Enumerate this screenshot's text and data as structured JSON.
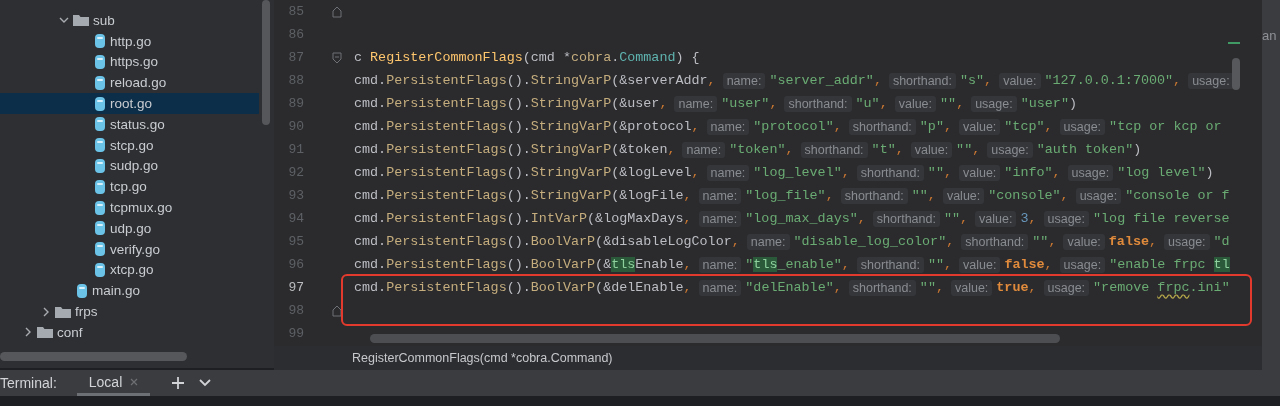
{
  "project_tree": [
    {
      "children": [
        {
          "children": [
            {
              "name": "sub",
              "kind": "folder",
              "expanded": true,
              "children": [
                {
                  "name": "http.go",
                  "kind": "file",
                  "selected": false
                },
                {
                  "name": "https.go",
                  "kind": "file",
                  "selected": false
                },
                {
                  "name": "reload.go",
                  "kind": "file",
                  "selected": false
                },
                {
                  "name": "root.go",
                  "kind": "file",
                  "selected": true
                },
                {
                  "name": "status.go",
                  "kind": "file",
                  "selected": false
                },
                {
                  "name": "stcp.go",
                  "kind": "file",
                  "selected": false
                },
                {
                  "name": "sudp.go",
                  "kind": "file",
                  "selected": false
                },
                {
                  "name": "tcp.go",
                  "kind": "file",
                  "selected": false
                },
                {
                  "name": "tcpmux.go",
                  "kind": "file",
                  "selected": false
                },
                {
                  "name": "udp.go",
                  "kind": "file",
                  "selected": false
                },
                {
                  "name": "verify.go",
                  "kind": "file",
                  "selected": false
                },
                {
                  "name": "xtcp.go",
                  "kind": "file",
                  "selected": false
                }
              ]
            },
            {
              "name": "main.go",
              "kind": "file",
              "selected": false
            }
          ]
        },
        {
          "name": "frps",
          "kind": "folder",
          "expanded": false
        }
      ]
    },
    {
      "name": "conf",
      "kind": "folder",
      "expanded": false
    }
  ],
  "editor": {
    "lines": [
      {
        "number": "85",
        "kind": "closer",
        "current": false,
        "boxed": false
      },
      {
        "number": "86",
        "kind": "plain",
        "current": false,
        "boxed": false
      },
      {
        "number": "87",
        "kind": "opener",
        "current": false,
        "boxed": false,
        "tokens": [
          {
            "kind": "plain",
            "text": "c "
          },
          {
            "kind": "func",
            "text": "RegisterCommonFlags"
          },
          {
            "kind": "plain",
            "text": "(cmd *"
          },
          {
            "kind": "method",
            "text": "cobra"
          },
          {
            "kind": "plain",
            "text": "."
          },
          {
            "kind": "type",
            "text": "Command"
          },
          {
            "kind": "plain",
            "text": ") {"
          }
        ]
      },
      {
        "number": "88",
        "kind": "plain",
        "current": false,
        "boxed": false,
        "tokens": [
          {
            "kind": "plain",
            "text": "cmd."
          },
          {
            "kind": "method",
            "text": "PersistentFlags"
          },
          {
            "kind": "plain",
            "text": "()."
          },
          {
            "kind": "method",
            "text": "StringVarP"
          },
          {
            "kind": "plain",
            "text": "(&serverAddr"
          },
          {
            "kind": "comma",
            "text": ","
          },
          {
            "kind": "hint",
            "text": "name:"
          },
          {
            "kind": "string",
            "text": "\"server_addr\""
          },
          {
            "kind": "comma",
            "text": ","
          },
          {
            "kind": "hint",
            "text": "shorthand:"
          },
          {
            "kind": "string",
            "text": "\"s\""
          },
          {
            "kind": "comma",
            "text": ","
          },
          {
            "kind": "hint",
            "text": "value:"
          },
          {
            "kind": "string",
            "text": "\"127.0.0.1:7000\""
          },
          {
            "kind": "comma",
            "text": ","
          },
          {
            "kind": "hint",
            "text": "usage:"
          }
        ]
      },
      {
        "number": "89",
        "kind": "plain",
        "current": false,
        "boxed": false,
        "tokens": [
          {
            "kind": "plain",
            "text": "cmd."
          },
          {
            "kind": "method",
            "text": "PersistentFlags"
          },
          {
            "kind": "plain",
            "text": "()."
          },
          {
            "kind": "method",
            "text": "StringVarP"
          },
          {
            "kind": "plain",
            "text": "(&user"
          },
          {
            "kind": "comma",
            "text": ","
          },
          {
            "kind": "hint",
            "text": "name:"
          },
          {
            "kind": "string",
            "text": "\"user\""
          },
          {
            "kind": "comma",
            "text": ","
          },
          {
            "kind": "hint",
            "text": "shorthand:"
          },
          {
            "kind": "string",
            "text": "\"u\""
          },
          {
            "kind": "comma",
            "text": ","
          },
          {
            "kind": "hint",
            "text": "value:"
          },
          {
            "kind": "string",
            "text": "\"\""
          },
          {
            "kind": "comma",
            "text": ","
          },
          {
            "kind": "hint",
            "text": "usage:"
          },
          {
            "kind": "string",
            "text": "\"user\""
          },
          {
            "kind": "plain",
            "text": ")"
          }
        ]
      },
      {
        "number": "90",
        "kind": "plain",
        "current": false,
        "boxed": false,
        "tokens": [
          {
            "kind": "plain",
            "text": "cmd."
          },
          {
            "kind": "method",
            "text": "PersistentFlags"
          },
          {
            "kind": "plain",
            "text": "()."
          },
          {
            "kind": "method",
            "text": "StringVarP"
          },
          {
            "kind": "plain",
            "text": "(&protocol"
          },
          {
            "kind": "comma",
            "text": ","
          },
          {
            "kind": "hint",
            "text": "name:"
          },
          {
            "kind": "string",
            "text": "\"protocol\""
          },
          {
            "kind": "comma",
            "text": ","
          },
          {
            "kind": "hint",
            "text": "shorthand:"
          },
          {
            "kind": "string",
            "text": "\"p\""
          },
          {
            "kind": "comma",
            "text": ","
          },
          {
            "kind": "hint",
            "text": "value:"
          },
          {
            "kind": "string",
            "text": "\"tcp\""
          },
          {
            "kind": "comma",
            "text": ","
          },
          {
            "kind": "hint",
            "text": "usage:"
          },
          {
            "kind": "string",
            "text": "\"tcp or kcp or"
          }
        ]
      },
      {
        "number": "91",
        "kind": "plain",
        "current": false,
        "boxed": false,
        "tokens": [
          {
            "kind": "plain",
            "text": "cmd."
          },
          {
            "kind": "method",
            "text": "PersistentFlags"
          },
          {
            "kind": "plain",
            "text": "()."
          },
          {
            "kind": "method",
            "text": "StringVarP"
          },
          {
            "kind": "plain",
            "text": "(&token"
          },
          {
            "kind": "comma",
            "text": ","
          },
          {
            "kind": "hint",
            "text": "name:"
          },
          {
            "kind": "string",
            "text": "\"token\""
          },
          {
            "kind": "comma",
            "text": ","
          },
          {
            "kind": "hint",
            "text": "shorthand:"
          },
          {
            "kind": "string",
            "text": "\"t\""
          },
          {
            "kind": "comma",
            "text": ","
          },
          {
            "kind": "hint",
            "text": "value:"
          },
          {
            "kind": "string",
            "text": "\"\""
          },
          {
            "kind": "comma",
            "text": ","
          },
          {
            "kind": "hint",
            "text": "usage:"
          },
          {
            "kind": "string",
            "text": "\"auth token\""
          },
          {
            "kind": "plain",
            "text": ")"
          }
        ]
      },
      {
        "number": "92",
        "kind": "plain",
        "current": false,
        "boxed": false,
        "tokens": [
          {
            "kind": "plain",
            "text": "cmd."
          },
          {
            "kind": "method",
            "text": "PersistentFlags"
          },
          {
            "kind": "plain",
            "text": "()."
          },
          {
            "kind": "method",
            "text": "StringVarP"
          },
          {
            "kind": "plain",
            "text": "(&logLevel"
          },
          {
            "kind": "comma",
            "text": ","
          },
          {
            "kind": "hint",
            "text": "name:"
          },
          {
            "kind": "string",
            "text": "\"log_level\""
          },
          {
            "kind": "comma",
            "text": ","
          },
          {
            "kind": "hint",
            "text": "shorthand:"
          },
          {
            "kind": "string",
            "text": "\"\""
          },
          {
            "kind": "comma",
            "text": ","
          },
          {
            "kind": "hint",
            "text": "value:"
          },
          {
            "kind": "string",
            "text": "\"info\""
          },
          {
            "kind": "comma",
            "text": ","
          },
          {
            "kind": "hint",
            "text": "usage:"
          },
          {
            "kind": "string",
            "text": "\"log level\""
          },
          {
            "kind": "plain",
            "text": ")"
          }
        ]
      },
      {
        "number": "93",
        "kind": "plain",
        "current": false,
        "boxed": false,
        "tokens": [
          {
            "kind": "plain",
            "text": "cmd."
          },
          {
            "kind": "method",
            "text": "PersistentFlags"
          },
          {
            "kind": "plain",
            "text": "()."
          },
          {
            "kind": "method",
            "text": "StringVarP"
          },
          {
            "kind": "plain",
            "text": "(&logFile"
          },
          {
            "kind": "comma",
            "text": ","
          },
          {
            "kind": "hint",
            "text": "name:"
          },
          {
            "kind": "string",
            "text": "\"log_file\""
          },
          {
            "kind": "comma",
            "text": ","
          },
          {
            "kind": "hint",
            "text": "shorthand:"
          },
          {
            "kind": "string",
            "text": "\"\""
          },
          {
            "kind": "comma",
            "text": ","
          },
          {
            "kind": "hint",
            "text": "value:"
          },
          {
            "kind": "string",
            "text": "\"console\""
          },
          {
            "kind": "comma",
            "text": ","
          },
          {
            "kind": "hint",
            "text": "usage:"
          },
          {
            "kind": "string",
            "text": "\"console or f"
          }
        ]
      },
      {
        "number": "94",
        "kind": "plain",
        "current": false,
        "boxed": false,
        "tokens": [
          {
            "kind": "plain",
            "text": "cmd."
          },
          {
            "kind": "method",
            "text": "PersistentFlags"
          },
          {
            "kind": "plain",
            "text": "()."
          },
          {
            "kind": "method",
            "text": "IntVarP"
          },
          {
            "kind": "plain",
            "text": "(&logMaxDays"
          },
          {
            "kind": "comma",
            "text": ","
          },
          {
            "kind": "hint",
            "text": "name:"
          },
          {
            "kind": "string",
            "text": "\"log_max_days\""
          },
          {
            "kind": "comma",
            "text": ","
          },
          {
            "kind": "hint",
            "text": "shorthand:"
          },
          {
            "kind": "string",
            "text": "\"\""
          },
          {
            "kind": "comma",
            "text": ","
          },
          {
            "kind": "hint",
            "text": "value:"
          },
          {
            "kind": "number",
            "text": "3"
          },
          {
            "kind": "comma",
            "text": ","
          },
          {
            "kind": "hint",
            "text": "usage:"
          },
          {
            "kind": "string",
            "text": "\"log file reverse"
          }
        ]
      },
      {
        "number": "95",
        "kind": "plain",
        "current": false,
        "boxed": false,
        "tokens": [
          {
            "kind": "plain",
            "text": "cmd."
          },
          {
            "kind": "method",
            "text": "PersistentFlags"
          },
          {
            "kind": "plain",
            "text": "()."
          },
          {
            "kind": "method",
            "text": "BoolVarP"
          },
          {
            "kind": "plain",
            "text": "(&disableLogColor"
          },
          {
            "kind": "comma",
            "text": ","
          },
          {
            "kind": "hint",
            "text": "name:"
          },
          {
            "kind": "string",
            "text": "\"disable_log_color\""
          },
          {
            "kind": "comma",
            "text": ","
          },
          {
            "kind": "hint",
            "text": "shorthand:"
          },
          {
            "kind": "string",
            "text": "\"\""
          },
          {
            "kind": "comma",
            "text": ","
          },
          {
            "kind": "hint",
            "text": "value:"
          },
          {
            "kind": "keyword",
            "text": "false"
          },
          {
            "kind": "comma",
            "text": ","
          },
          {
            "kind": "hint",
            "text": "usage:"
          },
          {
            "kind": "string",
            "text": "\"d"
          }
        ]
      },
      {
        "number": "96",
        "kind": "plain",
        "current": false,
        "boxed": false,
        "tokens": [
          {
            "kind": "plain",
            "text": "cmd."
          },
          {
            "kind": "method",
            "text": "PersistentFlags"
          },
          {
            "kind": "plain",
            "text": "()."
          },
          {
            "kind": "method",
            "text": "BoolVarP"
          },
          {
            "kind": "plain",
            "text": "(&"
          },
          {
            "kind": "match",
            "text": "tls"
          },
          {
            "kind": "plain",
            "text": "Enable"
          },
          {
            "kind": "comma",
            "text": ","
          },
          {
            "kind": "hint",
            "text": "name:"
          },
          {
            "kind": "string",
            "text": "\""
          },
          {
            "kind": "match",
            "text": "tls"
          },
          {
            "kind": "string",
            "text": "_enable\""
          },
          {
            "kind": "comma",
            "text": ","
          },
          {
            "kind": "hint",
            "text": "shorthand:"
          },
          {
            "kind": "string",
            "text": "\"\""
          },
          {
            "kind": "comma",
            "text": ","
          },
          {
            "kind": "hint",
            "text": "value:"
          },
          {
            "kind": "keyword",
            "text": "false"
          },
          {
            "kind": "comma",
            "text": ","
          },
          {
            "kind": "hint",
            "text": "usage:"
          },
          {
            "kind": "string",
            "text": "\"enable frpc "
          },
          {
            "kind": "match",
            "text": "tl"
          }
        ]
      },
      {
        "number": "97",
        "kind": "plain",
        "current": true,
        "boxed": true,
        "tokens": [
          {
            "kind": "plain",
            "text": "cmd."
          },
          {
            "kind": "method",
            "text": "PersistentFlags"
          },
          {
            "kind": "plain",
            "text": "()."
          },
          {
            "kind": "method",
            "text": "BoolVarP"
          },
          {
            "kind": "plain",
            "text": "(&delEnable"
          },
          {
            "kind": "comma",
            "text": ","
          },
          {
            "kind": "hint",
            "text": "name:"
          },
          {
            "kind": "string",
            "text": "\"delEnable\""
          },
          {
            "kind": "comma",
            "text": ","
          },
          {
            "kind": "hint",
            "text": "shorthand:"
          },
          {
            "kind": "string",
            "text": "\"\""
          },
          {
            "kind": "comma",
            "text": ","
          },
          {
            "kind": "hint",
            "text": "value:"
          },
          {
            "kind": "keyword",
            "text": "true"
          },
          {
            "kind": "comma",
            "text": ","
          },
          {
            "kind": "hint",
            "text": "usage:"
          },
          {
            "kind": "string",
            "text": "\"remove "
          },
          {
            "kind": "typo",
            "text": "frpc"
          },
          {
            "kind": "string",
            "text": ".ini\""
          }
        ]
      },
      {
        "number": "98",
        "kind": "closer",
        "current": false,
        "boxed": true
      },
      {
        "number": "99",
        "kind": "plain",
        "current": false,
        "boxed": false
      }
    ],
    "breadcrumb": "RegisterCommonFlags(cmd *cobra.Command)"
  },
  "side_panel": {
    "text": "an"
  },
  "terminal": {
    "label": "Terminal:",
    "tabs": [
      {
        "label": "Local",
        "selected": true
      }
    ]
  }
}
